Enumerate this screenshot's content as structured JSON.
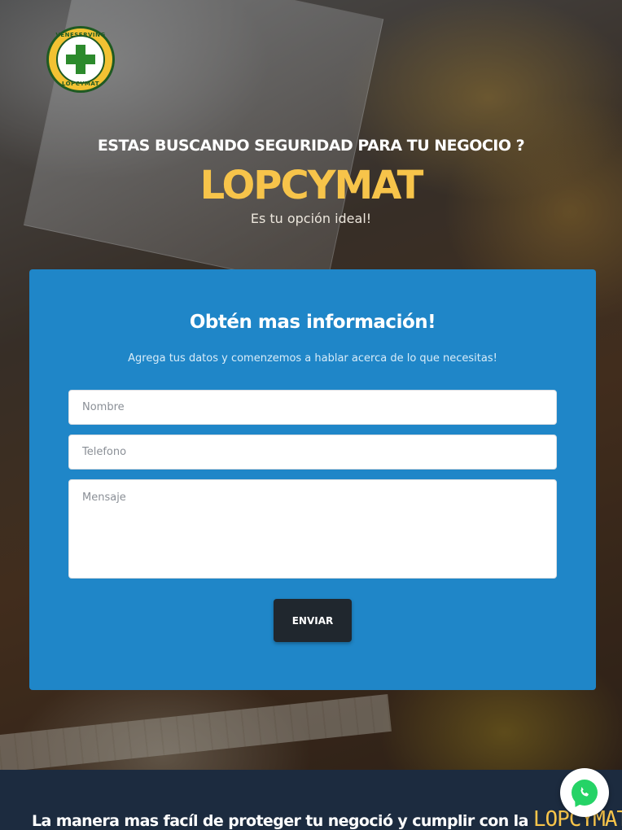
{
  "logo": {
    "ring_top": "VENESERVING",
    "ring_bottom": "LOPCYMAT",
    "icon": "green-cross-icon"
  },
  "hero": {
    "question": "ESTAS BUSCANDO SEGURIDAD PARA TU NEGOCIO ?",
    "brand": "LOPCYMAT",
    "subtitle": "Es tu opción ideal!"
  },
  "form": {
    "title": "Obtén mas información!",
    "description": "Agrega tus datos y comenzemos a hablar acerca de lo que necesitas!",
    "name_placeholder": "Nombre",
    "phone_placeholder": "Telefono",
    "message_placeholder": "Mensaje",
    "submit_label": "ENVIAR"
  },
  "band": {
    "text": "La manera mas facíl de proteger tu negoció y cumplir con la ",
    "brand": "LOPCYMAT"
  },
  "whatsapp": {
    "icon": "whatsapp-icon"
  },
  "colors": {
    "brand_yellow": "#f7c44a",
    "card_blue": "#1f86c8",
    "button_dark": "#20272e",
    "band_navy": "#1c2b3f",
    "whatsapp_green": "#25d366"
  }
}
